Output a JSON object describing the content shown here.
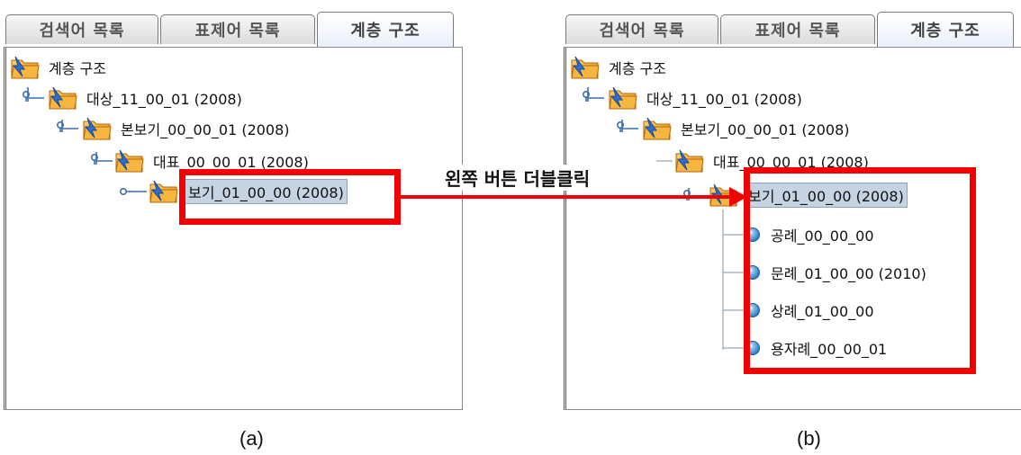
{
  "tabs": [
    "검색어 목록",
    "표제어 목록",
    "계층 구조"
  ],
  "tree": {
    "root": "계층 구조",
    "level1": "대상_11_00_01 (2008)",
    "level2": "본보기_00_00_01 (2008)",
    "level3": "대표_00_00_01 (2008)",
    "level4": "보기_01_00_00 (2008)",
    "children": [
      "공례_00_00_00",
      "문례_01_00_00 (2010)",
      "상례_01_00_00",
      "용자례_00_00_01"
    ]
  },
  "action_label": "왼쪽 버튼 더블클릭",
  "captions": {
    "a": "(a)",
    "b": "(b)"
  },
  "colors": {
    "highlight": "#f40000",
    "selection": "#c5d3e3",
    "folder": "#f5a623",
    "bubble": "#2f8fd0"
  },
  "icons": {
    "node": "folder-icon",
    "leaf": "bubble-icon"
  }
}
